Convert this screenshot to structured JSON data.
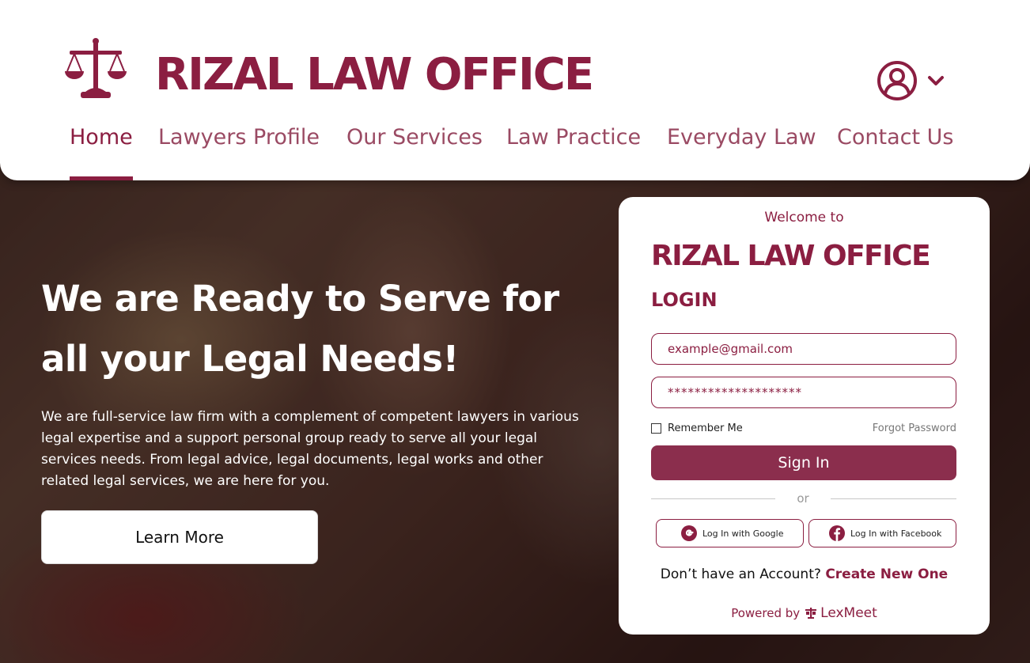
{
  "brand": {
    "name": "RIZAL LAW OFFICE"
  },
  "header": {
    "nav": [
      {
        "label": "Home",
        "active": true
      },
      {
        "label": "Lawyers Profile",
        "active": false
      },
      {
        "label": "Our Services",
        "active": false
      },
      {
        "label": "Law Practice",
        "active": false
      },
      {
        "label": "Everyday Law",
        "active": false
      },
      {
        "label": "Contact Us",
        "active": false
      }
    ]
  },
  "hero": {
    "title_line1": "We are Ready to Serve for",
    "title_line2": "all your Legal Needs!",
    "description": "We are full-service law firm with a complement of competent lawyers in various legal expertise and a support personal group ready to serve all your legal services needs. From legal advice, legal documents, legal works and other related legal services, we are here for you.",
    "cta_label": "Learn More"
  },
  "login": {
    "welcome": "Welcome to",
    "brand": "RIZAL LAW OFFICE",
    "title": "LOGIN",
    "email_placeholder": "example@gmail.com",
    "password_value": "********************",
    "remember_label": "Remember Me",
    "remember_checked": false,
    "forgot_label": "Forgot Password",
    "signin_label": "Sign In",
    "or_label": "or",
    "google_label": "Log In with Google",
    "facebook_label": "Log In with Facebook",
    "no_account_text": "Don’t have an Account?",
    "create_label": "Create New One",
    "powered_by": "Powered by",
    "powered_brand": "LexMeet"
  },
  "colors": {
    "accent": "#8b1e41",
    "button": "#8b2e4d",
    "nav_text": "#9a4a63"
  },
  "icons": [
    "scales-of-justice-icon",
    "user-account-icon",
    "chevron-down-icon",
    "google-icon",
    "facebook-icon",
    "lexmeet-logo-icon"
  ]
}
